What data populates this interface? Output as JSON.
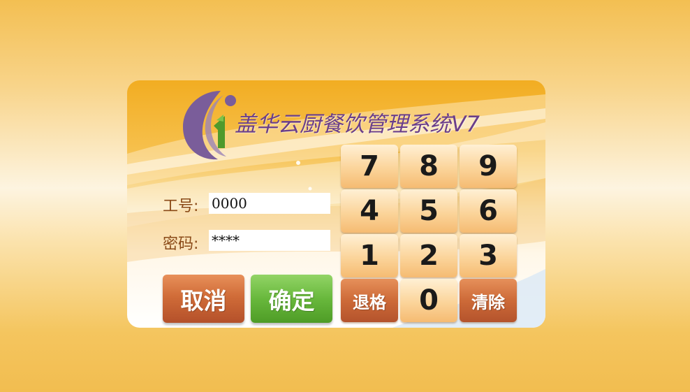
{
  "app": {
    "title": "盖华云厨餐饮管理系统V7"
  },
  "login": {
    "employee_id_label": "工号:",
    "employee_id_value": "0000",
    "password_label": "密码:",
    "password_value": "****"
  },
  "actions": {
    "cancel_label": "取消",
    "confirm_label": "确定"
  },
  "keypad": {
    "keys": [
      "7",
      "8",
      "9",
      "4",
      "5",
      "6",
      "1",
      "2",
      "3",
      "退格",
      "0",
      "清除"
    ]
  },
  "colors": {
    "title": "#6a3e8a",
    "label": "#8a4a18",
    "cancel": "#c9622f",
    "confirm": "#62b236",
    "keypad_key": "#fbd49a"
  },
  "icons": {
    "logo": "restaurant-logo-icon"
  }
}
